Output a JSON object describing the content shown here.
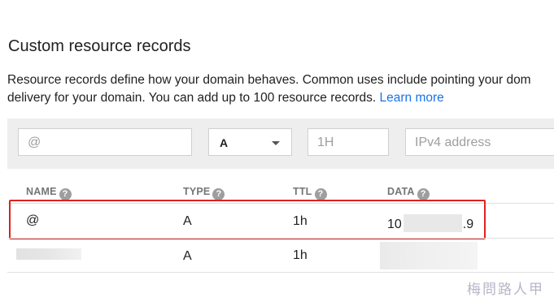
{
  "section": {
    "title": "Custom resource records",
    "description_line1": "Resource records define how your domain behaves. Common uses include pointing your dom",
    "description_line2": "delivery for your domain. You can add up to 100 resource records. ",
    "learn_more": "Learn more"
  },
  "entry": {
    "name_placeholder": "@",
    "type_value": "A",
    "ttl_placeholder": "1H",
    "data_placeholder": "IPv4 address"
  },
  "table": {
    "headers": {
      "name": "NAME",
      "type": "TYPE",
      "ttl": "TTL",
      "data": "DATA"
    },
    "help_glyph": "?",
    "rows": [
      {
        "name": "@",
        "type": "A",
        "ttl": "1h",
        "data_start": "10",
        "data_end": ".9"
      },
      {
        "name": "",
        "type": "A",
        "ttl": "1h"
      }
    ]
  },
  "watermark": "梅問路人甲",
  "colors": {
    "highlight": "#e02020",
    "link": "#1a73e8"
  }
}
